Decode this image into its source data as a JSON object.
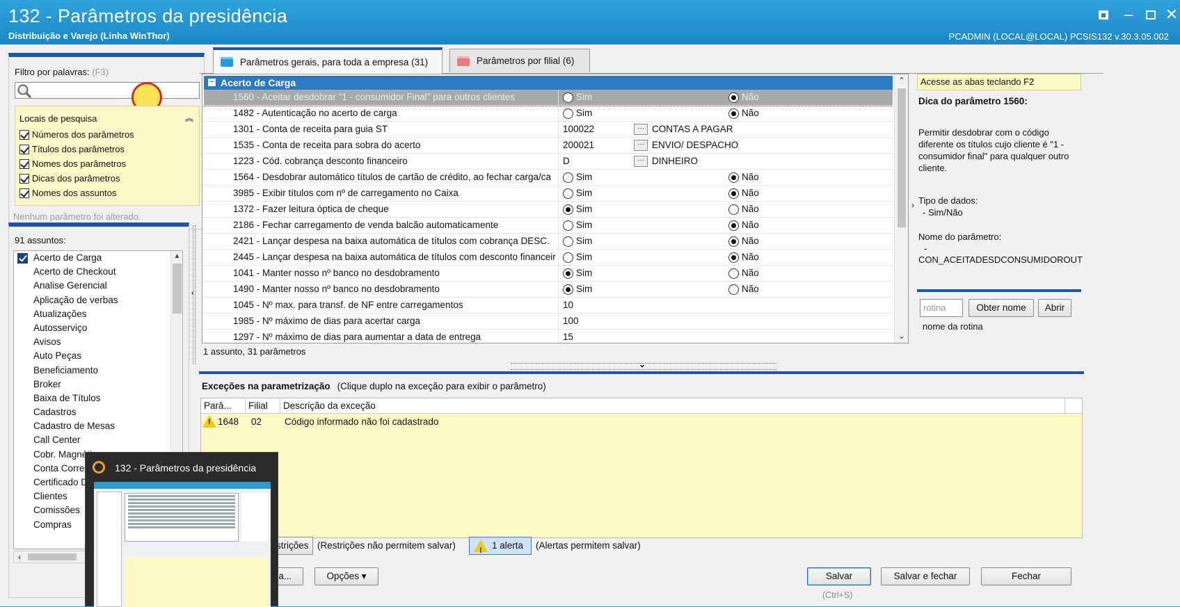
{
  "window": {
    "title": "132 - Parâmetros da presidência",
    "subtitle": "Distribuição e Varejo (Linha WinThor)",
    "user_info": "PCADMIN (LOCAL@LOCAL)   PCSIS132  v.30.3.05.002",
    "controls": [
      "restore-alt-icon",
      "minimize-icon",
      "maximize-icon",
      "close-icon"
    ]
  },
  "filter": {
    "label": "Filtro por palavras:",
    "shortcut": "(F3)",
    "value": "",
    "locais": {
      "title": "Locais de pesquisa",
      "items": [
        {
          "label": "Números dos parâmetros",
          "checked": true
        },
        {
          "label": "Títulos dos parâmetros",
          "checked": true
        },
        {
          "label": "Nomes dos parâmetros",
          "checked": true
        },
        {
          "label": "Dicas dos parâmetros",
          "checked": true
        },
        {
          "label": "Nomes dos assuntos",
          "checked": true
        }
      ]
    },
    "status": "Nenhum parâmetro foi alterado."
  },
  "assuntos": {
    "count_label": "91 assuntos:",
    "items": [
      {
        "label": "Acerto de Carga",
        "checked": true
      },
      {
        "label": "Acerto de Checkout"
      },
      {
        "label": "Analise Gerencial"
      },
      {
        "label": "Aplicação de verbas"
      },
      {
        "label": "Atualizações"
      },
      {
        "label": "Autosserviço"
      },
      {
        "label": "Avisos"
      },
      {
        "label": "Auto Peças"
      },
      {
        "label": "Beneficiamento"
      },
      {
        "label": "Broker"
      },
      {
        "label": "Baixa de Títulos"
      },
      {
        "label": "Cadastros"
      },
      {
        "label": "Cadastro de Mesas"
      },
      {
        "label": "Call Center"
      },
      {
        "label": "Cobr. Magnética"
      },
      {
        "label": "Conta Corrente"
      },
      {
        "label": "Certificado D"
      },
      {
        "label": "Clientes"
      },
      {
        "label": "Comissões"
      },
      {
        "label": "Compras"
      }
    ]
  },
  "tabs": [
    {
      "label": "Parâmetros gerais, para toda a empresa",
      "count": "(31)",
      "active": true
    },
    {
      "label": "Parâmetros por filial",
      "count": "(6)",
      "active": false
    }
  ],
  "grid": {
    "group": "Acerto de Carga",
    "rows": [
      {
        "name": "1560 - Aceitar desdobrar \"1 - consumidor Final\" para outros clientes",
        "type": "radio",
        "value": "Não",
        "selected": true
      },
      {
        "name": "1482 - Autenticação no acerto de carga",
        "type": "radio",
        "value": "Não"
      },
      {
        "name": "1301 - Conta de receita para guia ST",
        "type": "lookup",
        "code": "100022",
        "desc": "CONTAS A PAGAR"
      },
      {
        "name": "1535 - Conta de receita para sobra do acerto",
        "type": "lookup",
        "code": "200021",
        "desc": "ENVIO/ DESPACHO"
      },
      {
        "name": "1223 - Cód. cobrança desconto financeiro",
        "type": "lookup",
        "code": "D",
        "desc": "DINHEIRO"
      },
      {
        "name": "1564 - Desdobrar automático títulos de cartão de crédito, ao fechar carga/ca",
        "type": "radio",
        "value": "Não"
      },
      {
        "name": "3985 - Exibir títulos com nº de carregamento no Caixa",
        "type": "radio",
        "value": "Não"
      },
      {
        "name": "1372 - Fazer leitura óptica de cheque",
        "type": "radio",
        "value": "Sim"
      },
      {
        "name": "2186 - Fechar carregamento de venda balcão automaticamente",
        "type": "radio",
        "value": "Não"
      },
      {
        "name": "2421 - Lançar despesa na baixa automática de títulos com cobrança DESC.",
        "type": "radio",
        "value": "Não"
      },
      {
        "name": "2445 - Lançar despesa na baixa automática de títulos com desconto financeir",
        "type": "radio",
        "value": "Não"
      },
      {
        "name": "1041 - Manter nosso nº banco no desdobramento",
        "type": "radio",
        "value": "Sim"
      },
      {
        "name": "1490 - Manter nosso nº banco no desdobramento",
        "type": "radio",
        "value": "Sim"
      },
      {
        "name": "1045 - Nº max. para transf. de NF entre carregamentos",
        "type": "number",
        "code": "10"
      },
      {
        "name": "1985 - Nº máximo de dias para acertar carga",
        "type": "number",
        "code": "100"
      },
      {
        "name": "1297 - Nº máximo de dias para aumentar a data de entrega",
        "type": "number",
        "code": "15"
      }
    ],
    "sim_label": "Sim",
    "nao_label": "Não",
    "status": "1 assunto, 31 parâmetros"
  },
  "tip": {
    "hint": "Acesse as abas teclando F2",
    "title": "Dica do parâmetro 1560:",
    "text": "Permitir desdobrar com o código diferente os títulos cujo cliente é \"1 - consumidor final\" para qualquer outro cliente.",
    "type_label": "Tipo de dados:",
    "type_value": "- Sim/Não",
    "name_label": "Nome do parâmetro:",
    "name_dash": "-",
    "name_value": "CON_ACEITADESDCONSUMIDOROUT",
    "rotina_placeholder": "rotina",
    "obter_nome": "Obter nome",
    "abrir": "Abrir",
    "rotina_nome": "nome da rotina"
  },
  "excecoes": {
    "title": "Exceções na parametrização",
    "subtitle": "(Clique duplo na exceção para exibir o parâmetro)",
    "columns": [
      "Parâ...",
      "Filial",
      "Descrição da exceção"
    ],
    "rows": [
      {
        "param": "1648",
        "filial": "02",
        "desc": "Código informado não foi cadastrado"
      }
    ]
  },
  "footer": {
    "restricoes_btn": "strições",
    "restricoes_msg": "(Restrições não permitem salvar)",
    "alerta_btn": "1 alerta",
    "alerta_msg": "(Alertas permitem salvar)",
    "carga_btn": "ga...",
    "opcoes_btn": "Opções ▾",
    "salvar": "Salvar",
    "salvar_shortcut": "(Ctrl+S)",
    "salvar_fechar": "Salvar e fechar",
    "fechar": "Fechar"
  },
  "taskbar_thumb": {
    "title": "132 - Parâmetros da presidência"
  },
  "colors": {
    "titlebar": "#1b87c6",
    "accent": "#1f54a8",
    "group_header": "#2a79c2",
    "yellow_panel": "#fdf9c5"
  }
}
